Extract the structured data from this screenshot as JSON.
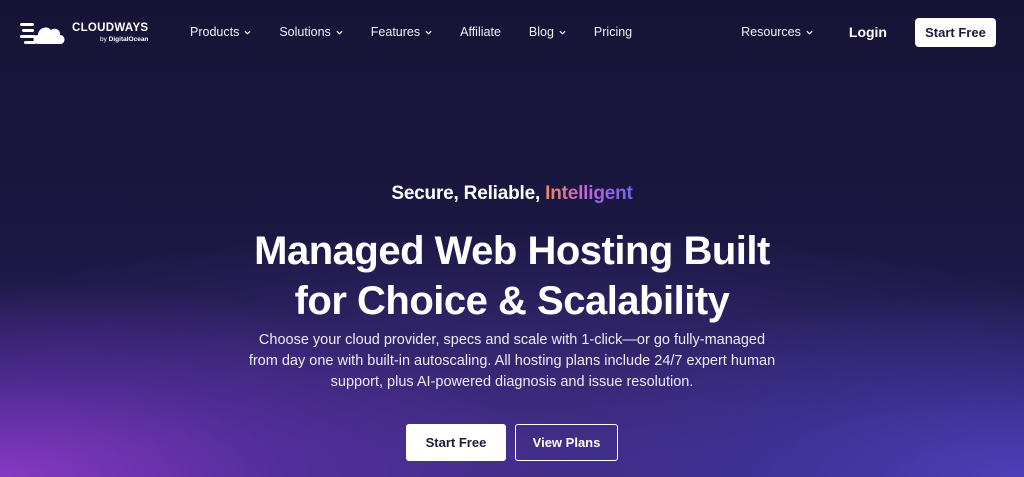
{
  "brand": {
    "name": "CLOUDWAYS",
    "by_prefix": "by",
    "by_company": "DigitalOcean"
  },
  "nav": {
    "items": [
      {
        "label": "Products",
        "dropdown": true
      },
      {
        "label": "Solutions",
        "dropdown": true
      },
      {
        "label": "Features",
        "dropdown": true
      },
      {
        "label": "Affiliate",
        "dropdown": false
      },
      {
        "label": "Blog",
        "dropdown": true
      },
      {
        "label": "Pricing",
        "dropdown": false
      }
    ],
    "resources_label": "Resources",
    "login_label": "Login",
    "start_free_label": "Start Free"
  },
  "hero": {
    "tagline_plain": "Secure, Reliable,",
    "tagline_accent": "Intelligent",
    "headline_line1": "Managed Web Hosting Built",
    "headline_line2": "for Choice & Scalability",
    "desc_line1": "Choose your cloud provider, specs and scale with 1-click—or go fully-managed",
    "desc_line2": "from day one with built-in autoscaling. All hosting plans include 24/7 expert human",
    "desc_line3": "support, plus AI-powered diagnosis and issue resolution.",
    "cta_primary": "Start Free",
    "cta_secondary": "View Plans"
  },
  "colors": {
    "background": "#141338",
    "accent_gradient_start": "#f08a5d",
    "accent_gradient_end": "#6a67f0"
  }
}
